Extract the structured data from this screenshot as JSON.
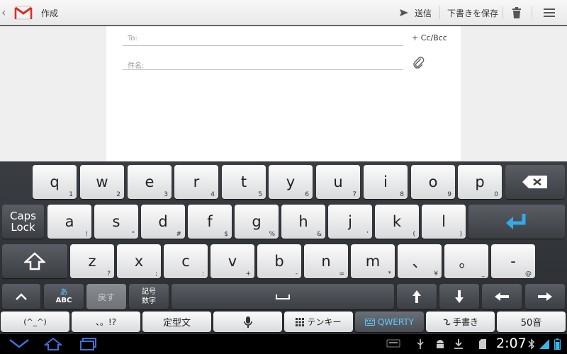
{
  "app": {
    "title": "作成"
  },
  "actionbar": {
    "send_label": "送信",
    "save_draft_label": "下書きを保存"
  },
  "compose": {
    "to_placeholder": "To:",
    "subject_placeholder": "件名:",
    "cc_bcc_label": "+ Cc/Bcc"
  },
  "keyboard": {
    "row1": [
      {
        "main": "q",
        "sub": "1"
      },
      {
        "main": "w",
        "sub": "2"
      },
      {
        "main": "e",
        "sub": "3"
      },
      {
        "main": "r",
        "sub": "4"
      },
      {
        "main": "t",
        "sub": "5"
      },
      {
        "main": "y",
        "sub": "6"
      },
      {
        "main": "u",
        "sub": "7"
      },
      {
        "main": "i",
        "sub": "8"
      },
      {
        "main": "o",
        "sub": "9"
      },
      {
        "main": "p",
        "sub": "0"
      }
    ],
    "row2": [
      {
        "main": "a",
        "sub": "!"
      },
      {
        "main": "s",
        "sub": "\""
      },
      {
        "main": "d",
        "sub": "#"
      },
      {
        "main": "f",
        "sub": "$"
      },
      {
        "main": "g",
        "sub": "%"
      },
      {
        "main": "h",
        "sub": "&"
      },
      {
        "main": "j",
        "sub": "'"
      },
      {
        "main": "k",
        "sub": "("
      },
      {
        "main": "l",
        "sub": ")"
      }
    ],
    "row3": [
      {
        "main": "z",
        "sub": "?"
      },
      {
        "main": "x",
        "sub": ";"
      },
      {
        "main": "c",
        "sub": ":"
      },
      {
        "main": "v",
        "sub": "+"
      },
      {
        "main": "b",
        "sub": "-"
      },
      {
        "main": "n",
        "sub": "="
      },
      {
        "main": "m",
        "sub": "*"
      },
      {
        "main": "、",
        "sub": "¥"
      },
      {
        "main": "。",
        "sub": "_"
      },
      {
        "main": "-",
        "sub": "@"
      }
    ],
    "caps_lock_line1": "Caps",
    "caps_lock_line2": "Lock",
    "mode_kana": "あ",
    "mode_abc": "ABC",
    "undo_label": "戻す",
    "symbols_line1": "記号",
    "symbols_line2": "数字",
    "emoticon_label": "(^_^)",
    "punct_label": "、。!?",
    "phrase_label": "定型文",
    "tenkey_label": "テンキー",
    "qwerty_label": "QWERTY",
    "handwriting_label": "手書き",
    "gojuon_label": "50音"
  },
  "status": {
    "time": "2:07"
  },
  "colors": {
    "accent_blue": "#5fc8ff",
    "enter_arrow": "#35a9e6"
  }
}
